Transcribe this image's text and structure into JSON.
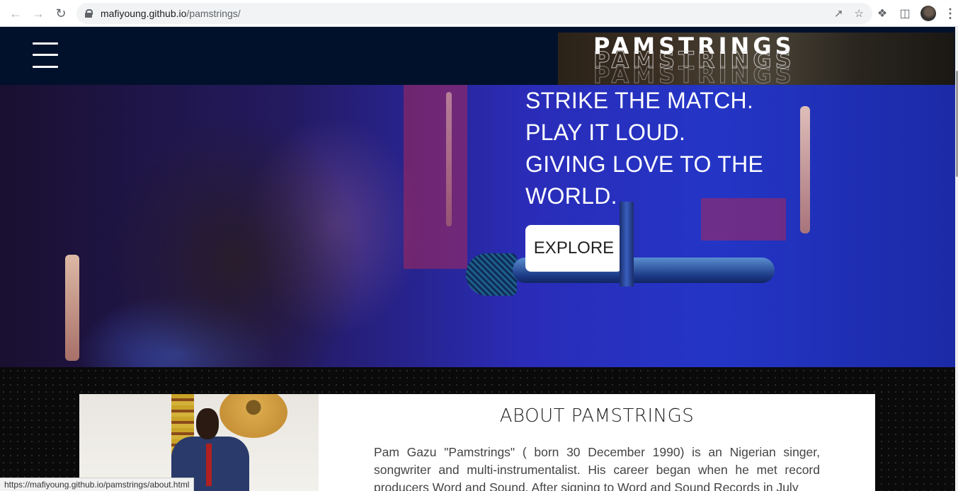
{
  "browser": {
    "url_domain": "mafiyoung.github.io",
    "url_path": "/pamstrings/",
    "status_url": "https://mafiyoung.github.io/pamstrings/about.html"
  },
  "header": {
    "logo_text": "PAMSTRINGS"
  },
  "hero": {
    "lines": [
      "STRIKE THE MATCH.",
      "PLAY IT LOUD.",
      "GIVING LOVE TO THE",
      "WORLD."
    ],
    "cta_label": "EXPLORE"
  },
  "about": {
    "title": "ABOUT PAMSTRINGS",
    "body": "Pam Gazu \"Pamstrings\" ( born 30 December 1990) is an Nigerian singer, songwriter and multi-instrumentalist. His career began when he met record producers Word and Sound. After signing to Word and Sound Records in July"
  },
  "colors": {
    "header_bg": "#02112b",
    "hero_blue": "#2435c6",
    "card_bg": "#ffffff"
  }
}
